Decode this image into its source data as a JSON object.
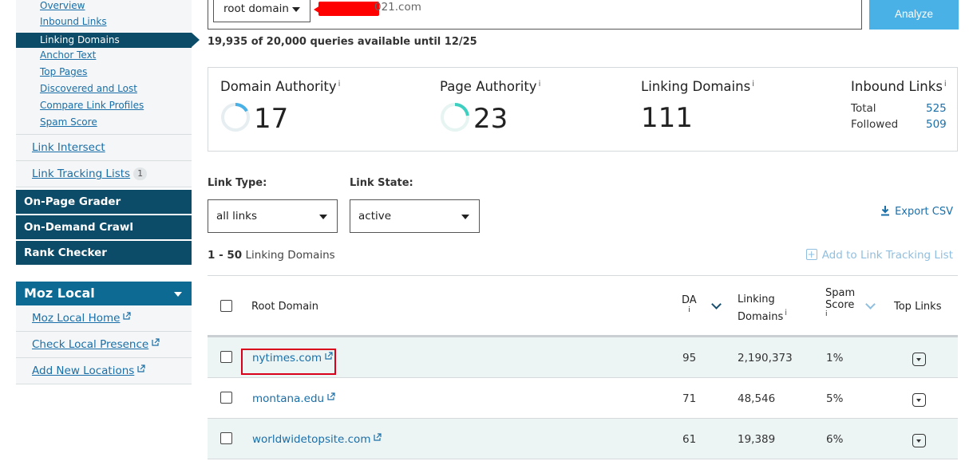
{
  "sidebar": {
    "sub_items": [
      {
        "label": "Overview"
      },
      {
        "label": "Inbound Links"
      },
      {
        "label": "Linking Domains",
        "active": true
      },
      {
        "label": "Anchor Text"
      },
      {
        "label": "Top Pages"
      },
      {
        "label": "Discovered and Lost"
      },
      {
        "label": "Compare Link Profiles"
      },
      {
        "label": "Spam Score"
      }
    ],
    "link_intersect": "Link Intersect",
    "link_tracking": {
      "label": "Link Tracking Lists",
      "count": "1"
    },
    "blocks": [
      "On-Page Grader",
      "On-Demand Crawl",
      "Rank Checker"
    ],
    "moz_local": {
      "title": "Moz Local",
      "links": [
        "Moz Local Home",
        "Check Local Presence",
        "Add New Locations"
      ]
    }
  },
  "search": {
    "scope": "root domain",
    "domain_visible": "021.com",
    "analyze_label": "Analyze",
    "quota": "19,935 of 20,000 queries available until 12/25"
  },
  "metrics": {
    "domain_authority": {
      "label": "Domain Authority",
      "info": "i",
      "value": "17",
      "fraction": 0.17
    },
    "page_authority": {
      "label": "Page Authority",
      "info": "i",
      "value": "23",
      "fraction": 0.23
    },
    "linking_domains": {
      "label": "Linking Domains",
      "info": "i",
      "value": "111"
    },
    "inbound_links": {
      "label": "Inbound Links",
      "info": "i",
      "total_label": "Total",
      "total": "525",
      "followed_label": "Followed",
      "followed": "509"
    }
  },
  "filters": {
    "link_type_label": "Link Type:",
    "link_type": "all links",
    "link_state_label": "Link State:",
    "link_state": "active",
    "export_label": "Export CSV",
    "range_bold": "1 - 50",
    "range_text": "Linking Domains",
    "add_tracking": "Add to Link Tracking List"
  },
  "table": {
    "headers": {
      "root_domain": "Root Domain",
      "da": "DA",
      "da_info": "i",
      "linking_domains_1": "Linking",
      "linking_domains_2": "Domains",
      "ld_info": "i",
      "spam_1": "Spam",
      "spam_2": "Score",
      "spam_info": "i",
      "top_links": "Top Links"
    },
    "rows": [
      {
        "domain": "nytimes.com",
        "da": "95",
        "linking_domains": "2,190,373",
        "spam": "1%"
      },
      {
        "domain": "montana.edu",
        "da": "71",
        "linking_domains": "48,546",
        "spam": "5%"
      },
      {
        "domain": "worldwidetopsite.com",
        "da": "61",
        "linking_domains": "19,389",
        "spam": "6%"
      }
    ]
  },
  "colors": {
    "nav_dark": "#0d4c68",
    "moz_local": "#0d6a92",
    "analyze": "#4ab1e6",
    "link": "#1a6fa8",
    "ring_accent": "#4ab1e6",
    "ring_pa": "#3fcfc0",
    "highlight": "#d9001b"
  }
}
